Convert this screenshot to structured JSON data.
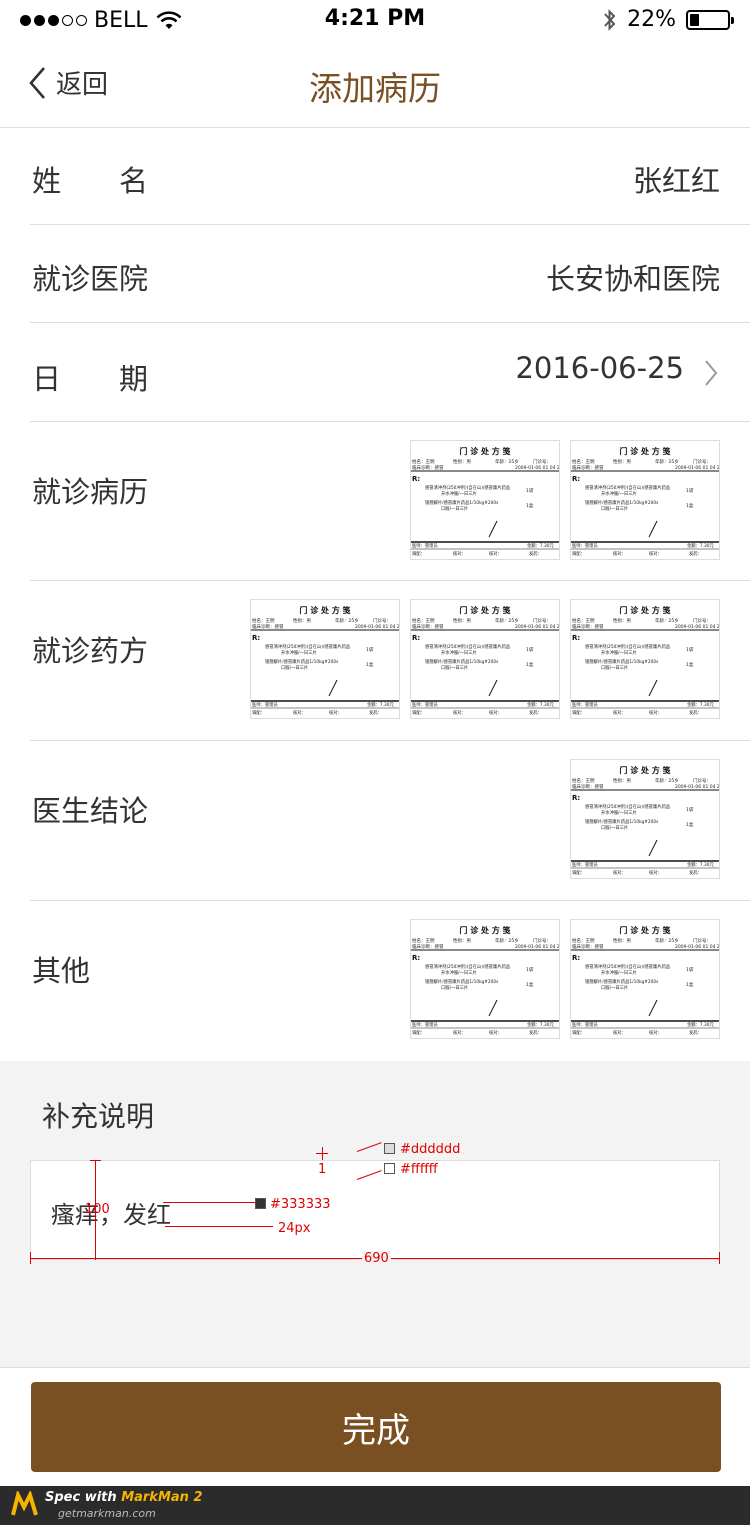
{
  "status_bar": {
    "carrier": "BELL",
    "time": "4:21 PM",
    "battery": "22%",
    "battery_level": 0.22
  },
  "nav": {
    "back_label": "返回",
    "title": "添加病历"
  },
  "form": {
    "name": {
      "label": "姓　　名",
      "value": "张红红"
    },
    "hospital": {
      "label": "就诊医院",
      "value": "长安协和医院"
    },
    "date": {
      "label": "日　　期",
      "value": "2016-06-25"
    },
    "records": {
      "label": "就诊病历",
      "image_count": 2
    },
    "prescriptions": {
      "label": "就诊药方",
      "image_count": 3
    },
    "conclusion": {
      "label": "医生结论",
      "image_count": 1
    },
    "other": {
      "label": "其他",
      "image_count": 2
    }
  },
  "prescription_thumb": {
    "title": "门 诊 处 方 笺",
    "name_line": "姓名：王明",
    "gender_line": "性别：男",
    "age_line": "年龄：25岁",
    "no_line": "门诊号：",
    "diag_line": "临床诊断：感冒",
    "date_line": "2009-01-06 01 04 22",
    "rx": "R:",
    "drug1": "感冒清冲剂(250冲剂)(自在山)/感冒康片药品",
    "drug1b": "开水冲服/一日三片",
    "drug2": "银翘解片/感冒康片药品1/10kg#200s",
    "drug2b": "口服/一日三片",
    "qty": "1袋",
    "qty2": "1盒",
    "doctor": "医师：管理员",
    "amount": "金额：7.30元",
    "dispense": "调配：",
    "check": "核对：",
    "issue": "发药："
  },
  "supplement": {
    "label": "补充说明",
    "text": "瘙痒，发红"
  },
  "spec": {
    "color_border": "#dddddd",
    "color_bg": "#ffffff",
    "color_text": "#333333",
    "thickness": "1",
    "height": "100",
    "font_size": "24px",
    "width": "690"
  },
  "done_button": {
    "label": "完成"
  },
  "footer": {
    "brand_prefix": "Spec with ",
    "brand_name": "MarkMan 2",
    "site": "getmarkman.com"
  },
  "colors": {
    "brand": "#7a5022",
    "divider": "#dddddd",
    "text": "#333333",
    "annotation": "#e00000"
  }
}
